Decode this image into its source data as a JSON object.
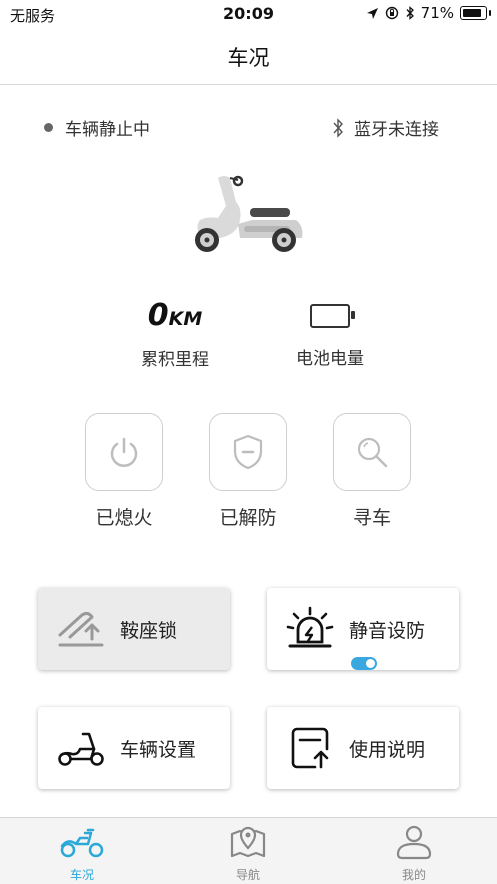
{
  "status_bar": {
    "carrier": "无服务",
    "time": "20:09",
    "battery_percent": "71%"
  },
  "nav": {
    "title": "车况"
  },
  "vehicle": {
    "motion_status": "车辆静止中",
    "bluetooth_status": "蓝牙未连接"
  },
  "stats": {
    "mileage_value": "0",
    "mileage_unit": "KM",
    "mileage_label": "累积里程",
    "battery_label": "电池电量"
  },
  "actions": [
    {
      "label": "已熄火",
      "icon": "power-icon"
    },
    {
      "label": "已解防",
      "icon": "shield-icon"
    },
    {
      "label": "寻车",
      "icon": "search-icon"
    }
  ],
  "cards": [
    {
      "label": "鞍座锁",
      "icon": "seat-lock-icon"
    },
    {
      "label": "静音设防",
      "icon": "alarm-light-icon",
      "toggle_on": true
    },
    {
      "label": "车辆设置",
      "icon": "scooter-icon"
    },
    {
      "label": "使用说明",
      "icon": "manual-icon"
    }
  ],
  "tabs": [
    {
      "label": "车况",
      "icon": "scooter-tab-icon",
      "active": true
    },
    {
      "label": "导航",
      "icon": "map-icon",
      "active": false
    },
    {
      "label": "我的",
      "icon": "user-icon",
      "active": false
    }
  ],
  "colors": {
    "accent": "#2aa8d8",
    "toggle": "#3aa8e0"
  }
}
